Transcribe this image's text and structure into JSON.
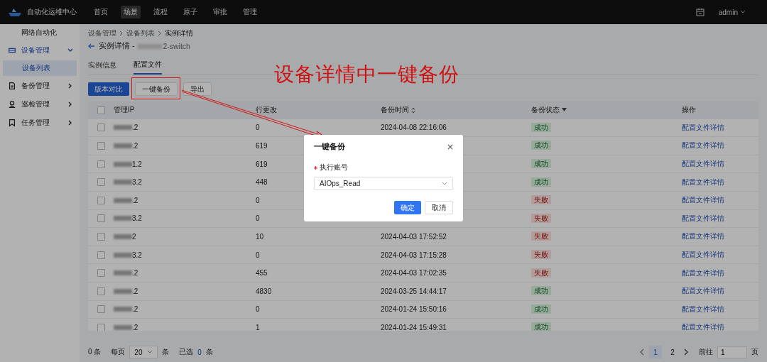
{
  "topbar": {
    "app_title": "自动化运维中心",
    "nav": [
      {
        "label": "首页",
        "selected": false
      },
      {
        "label": "场景",
        "selected": true
      },
      {
        "label": "流程",
        "selected": false
      },
      {
        "label": "原子",
        "selected": false
      },
      {
        "label": "审批",
        "selected": false
      },
      {
        "label": "管理",
        "selected": false
      }
    ],
    "user": "admin"
  },
  "sidebar": {
    "section": "网络自动化",
    "items": [
      {
        "label": "设备管理",
        "expanded": true,
        "children": [
          {
            "label": "设备列表",
            "selected": true
          }
        ]
      },
      {
        "label": "备份管理",
        "expanded": false
      },
      {
        "label": "巡检管理",
        "expanded": false
      },
      {
        "label": "任务管理",
        "expanded": false
      }
    ]
  },
  "breadcrumb": [
    "设备管理",
    "设备列表",
    "实例详情"
  ],
  "page_title": {
    "label": "实例详情 -",
    "suffix": "2-switch"
  },
  "tabs": [
    {
      "label": "实例信息",
      "selected": false
    },
    {
      "label": "配置文件",
      "selected": true
    }
  ],
  "toolbar": [
    {
      "label": "版本对比",
      "kind": "primary"
    },
    {
      "label": "一键备份",
      "kind": "default"
    },
    {
      "label": "导出",
      "kind": "default"
    }
  ],
  "table": {
    "select_all_checked": false,
    "columns": [
      "管理IP",
      "行更改",
      "备份时间",
      "备份状态",
      "操作"
    ],
    "rows": [
      {
        "checked": false,
        "ip": ".2",
        "changes": "0",
        "time": "2024-04-08 22:16:06",
        "status": "成功",
        "kind": "success",
        "action": "配置文件详情"
      },
      {
        "checked": false,
        "ip": ".2",
        "changes": "619",
        "status": "成功",
        "kind": "success",
        "action": "配置文件详情"
      },
      {
        "checked": false,
        "ip": "1.2",
        "changes": "619",
        "status": "成功",
        "kind": "success",
        "action": "配置文件详情"
      },
      {
        "checked": false,
        "ip": "3.2",
        "changes": "448",
        "status": "成功",
        "kind": "success",
        "action": "配置文件详情"
      },
      {
        "checked": false,
        "ip": ".2",
        "changes": "0",
        "status": "失败",
        "kind": "fail",
        "action": "配置文件详情"
      },
      {
        "checked": false,
        "ip": "3.2",
        "changes": "0",
        "status": "失败",
        "kind": "fail",
        "action": "配置文件详情"
      },
      {
        "checked": false,
        "ip": "2",
        "changes": "10",
        "time": "2024-04-03 17:52:52",
        "status": "失败",
        "kind": "fail",
        "action": "配置文件详情"
      },
      {
        "checked": false,
        "ip": "3.2",
        "changes": "0",
        "time": "2024-04-03 17:15:28",
        "status": "失败",
        "kind": "fail",
        "action": "配置文件详情"
      },
      {
        "checked": false,
        "ip": ".2",
        "changes": "455",
        "time": "2024-04-03 17:02:35",
        "status": "失败",
        "kind": "fail",
        "action": "配置文件详情"
      },
      {
        "checked": false,
        "ip": ".2",
        "changes": "4830",
        "time": "2024-03-25 14:44:17",
        "status": "成功",
        "kind": "success",
        "action": "配置文件详情"
      },
      {
        "checked": false,
        "ip": ".2",
        "changes": "0",
        "time": "2024-01-24 15:50:16",
        "status": "成功",
        "kind": "success",
        "action": "配置文件详情"
      },
      {
        "checked": false,
        "ip": ".2",
        "changes": "1",
        "time": "2024-01-24 15:49:31",
        "status": "成功",
        "kind": "success",
        "action": "配置文件详情"
      }
    ]
  },
  "footer": {
    "total": "0 条",
    "per_page_label": "每页",
    "page_size": "20",
    "per_page_unit": "条",
    "selected_label": "已选",
    "selected_count": "0",
    "selected_unit": "条",
    "pages": [
      {
        "label": "1",
        "selected": true
      },
      {
        "label": "2",
        "selected": false
      }
    ],
    "goto_label": "前往",
    "goto_value": "1",
    "goto_unit": "页"
  },
  "dialog": {
    "title": "一键备份",
    "field_label": "执行账号",
    "required": true,
    "field_value": "AIOps_Read",
    "buttons": [
      {
        "label": "确定",
        "kind": "primary"
      },
      {
        "label": "取消",
        "kind": "default"
      }
    ]
  },
  "annotation": {
    "text": "设备详情中一键备份"
  }
}
